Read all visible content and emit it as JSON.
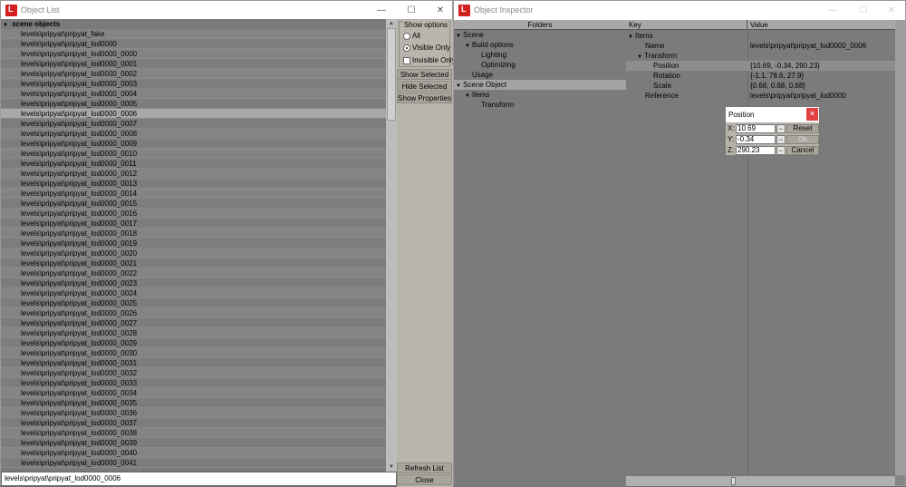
{
  "object_list_window": {
    "title": "Object List",
    "tree_root": "scene objects",
    "items": [
      "levels\\pripyat\\pripyat_fake",
      "levels\\pripyat\\pripyat_lod0000",
      "levels\\pripyat\\pripyat_lod0000_0000",
      "levels\\pripyat\\pripyat_lod0000_0001",
      "levels\\pripyat\\pripyat_lod0000_0002",
      "levels\\pripyat\\pripyat_lod0000_0003",
      "levels\\pripyat\\pripyat_lod0000_0004",
      "levels\\pripyat\\pripyat_lod0000_0005",
      "levels\\pripyat\\pripyat_lod0000_0006",
      "levels\\pripyat\\pripyat_lod0000_0007",
      "levels\\pripyat\\pripyat_lod0000_0008",
      "levels\\pripyat\\pripyat_lod0000_0009",
      "levels\\pripyat\\pripyat_lod0000_0010",
      "levels\\pripyat\\pripyat_lod0000_0011",
      "levels\\pripyat\\pripyat_lod0000_0012",
      "levels\\pripyat\\pripyat_lod0000_0013",
      "levels\\pripyat\\pripyat_lod0000_0014",
      "levels\\pripyat\\pripyat_lod0000_0015",
      "levels\\pripyat\\pripyat_lod0000_0016",
      "levels\\pripyat\\pripyat_lod0000_0017",
      "levels\\pripyat\\pripyat_lod0000_0018",
      "levels\\pripyat\\pripyat_lod0000_0019",
      "levels\\pripyat\\pripyat_lod0000_0020",
      "levels\\pripyat\\pripyat_lod0000_0021",
      "levels\\pripyat\\pripyat_lod0000_0022",
      "levels\\pripyat\\pripyat_lod0000_0023",
      "levels\\pripyat\\pripyat_lod0000_0024",
      "levels\\pripyat\\pripyat_lod0000_0025",
      "levels\\pripyat\\pripyat_lod0000_0026",
      "levels\\pripyat\\pripyat_lod0000_0027",
      "levels\\pripyat\\pripyat_lod0000_0028",
      "levels\\pripyat\\pripyat_lod0000_0029",
      "levels\\pripyat\\pripyat_lod0000_0030",
      "levels\\pripyat\\pripyat_lod0000_0031",
      "levels\\pripyat\\pripyat_lod0000_0032",
      "levels\\pripyat\\pripyat_lod0000_0033",
      "levels\\pripyat\\pripyat_lod0000_0034",
      "levels\\pripyat\\pripyat_lod0000_0035",
      "levels\\pripyat\\pripyat_lod0000_0036",
      "levels\\pripyat\\pripyat_lod0000_0037",
      "levels\\pripyat\\pripyat_lod0000_0038",
      "levels\\pripyat\\pripyat_lod0000_0039",
      "levels\\pripyat\\pripyat_lod0000_0040",
      "levels\\pripyat\\pripyat_lod0000_0041"
    ],
    "selected_index": 8,
    "show_options": {
      "label": "Show options",
      "options": [
        "All",
        "Visible Only",
        "Invisible Only"
      ],
      "selected": "Visible Only"
    },
    "buttons": {
      "show_selected": "Show Selected",
      "hide_selected": "Hide Selected",
      "show_properties": "Show Properties",
      "refresh_list": "Refresh List",
      "close": "Close"
    },
    "selected_path": "levels\\pripyat\\pripyat_lod0000_0006"
  },
  "object_inspector_window": {
    "title": "Object Inspector",
    "folders_header": "Folders",
    "folders": {
      "scene": "Scene",
      "build_options": "Build options",
      "lighting": "Lighting",
      "optimizing": "Optimizing",
      "usage": "Usage",
      "scene_object": "Scene Object",
      "items": "Items",
      "transform": "Transform"
    },
    "key_header": "Key",
    "value_header": "Value",
    "properties": {
      "items": "Items",
      "name_key": "Name",
      "name_value": "levels\\pripyat\\pripyat_lod0000_0006",
      "transform": "Transform",
      "position_key": "Position",
      "position_value": "{10.69, -0.34, 290.23}",
      "rotation_key": "Rotation",
      "rotation_value": "{-1.1, 78.6, 27.9}",
      "scale_key": "Scale",
      "scale_value": "{0.68, 0.68, 0.68}",
      "reference_key": "Reference",
      "reference_value": "levels\\pripyat\\pripyat_lod0000"
    }
  },
  "position_dialog": {
    "title": "Position",
    "x_label": "X:",
    "x_value": "10.69",
    "y_label": "Y:",
    "y_value": "-0.34",
    "z_label": "Z:",
    "z_value": "290.23",
    "reset": "Reset",
    "ok": "Ok",
    "cancel": "Cancel"
  }
}
